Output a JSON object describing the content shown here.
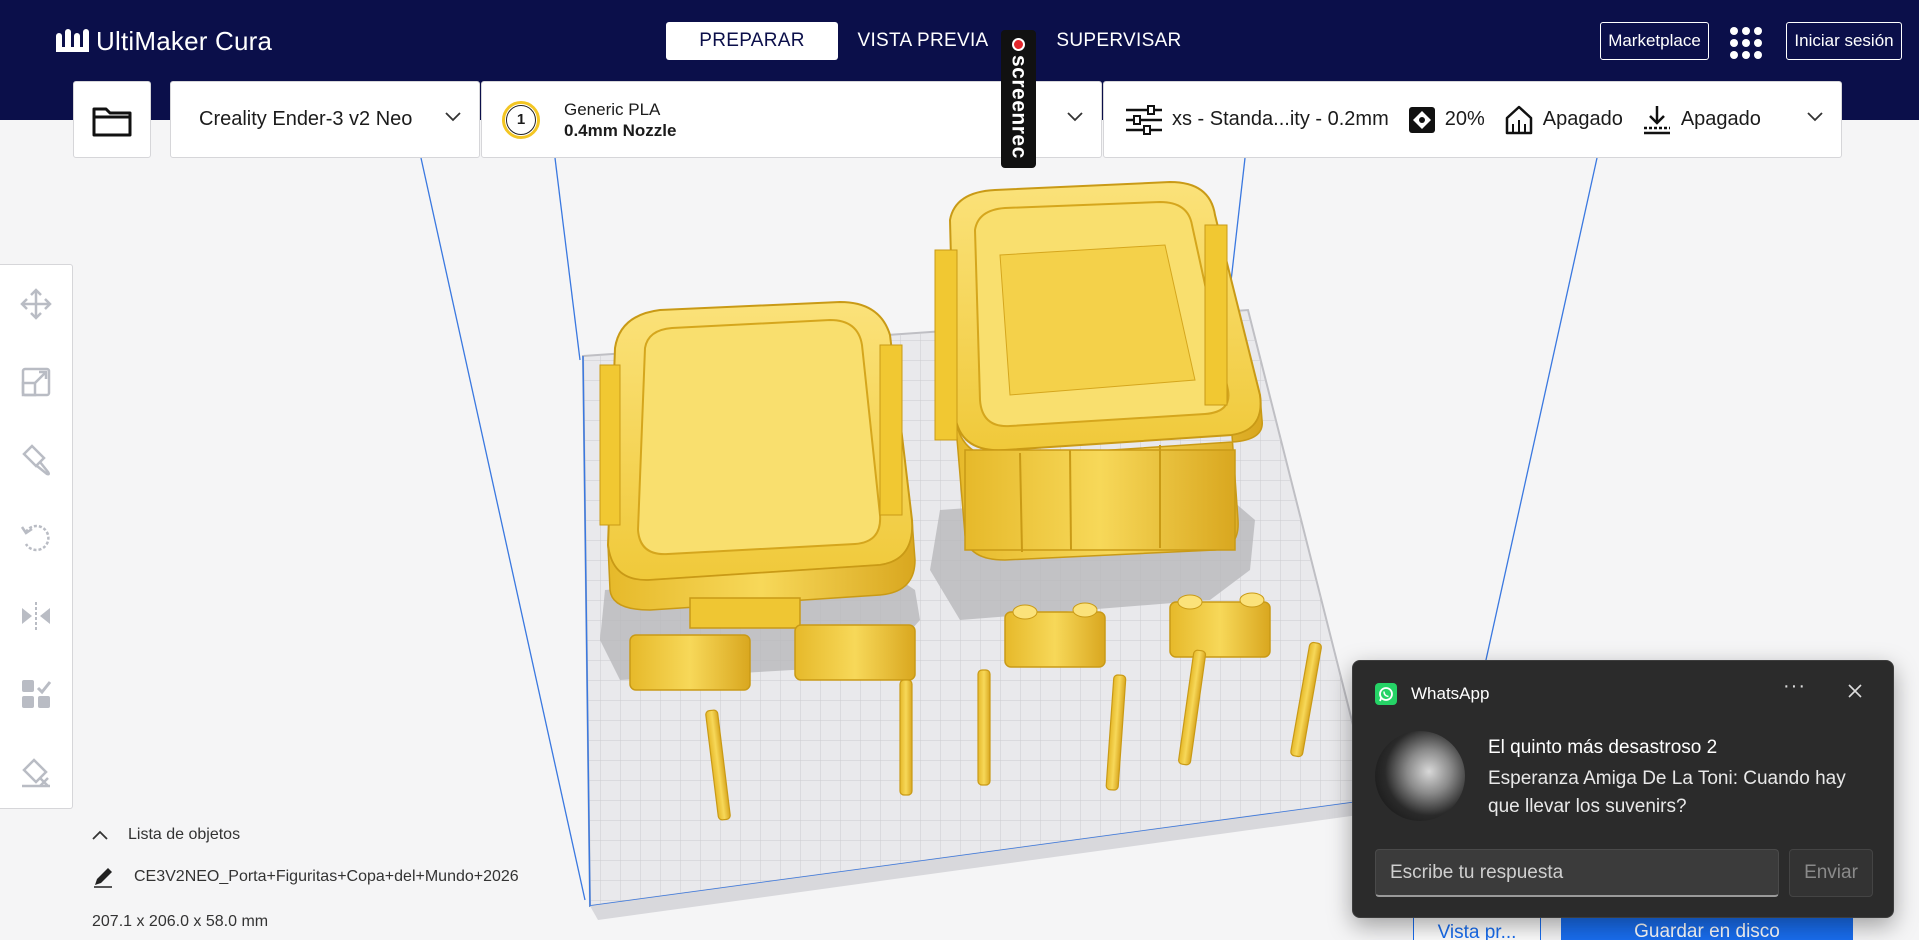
{
  "header": {
    "app_name": "UltiMaker Cura",
    "tabs": [
      {
        "label": "PREPARAR",
        "active": true
      },
      {
        "label": "VISTA PREVIA",
        "active": false
      },
      {
        "label": "SUPERVISAR",
        "active": false
      }
    ],
    "marketplace_label": "Marketplace",
    "signin_label": "Iniciar sesión"
  },
  "recording_badge": "screenrec",
  "printer_panel": {
    "printer_name": "Creality Ender-3 v2 Neo"
  },
  "material_panel": {
    "extruder_number": "1",
    "material_name": "Generic PLA",
    "nozzle": "0.4mm Nozzle"
  },
  "settings_panel": {
    "profile": "xs - Standa...ity - 0.2mm",
    "infill": "20%",
    "support": "Apagado",
    "adhesion": "Apagado"
  },
  "toolbar": {
    "tools": [
      "move-icon",
      "scale-icon",
      "paint-icon",
      "rotate-icon",
      "mirror-icon",
      "per-model-settings-icon",
      "support-blocker-icon"
    ]
  },
  "object_list": {
    "header": "Lista de objetos",
    "item": "CE3V2NEO_Porta+Figuritas+Copa+del+Mundo+2026",
    "dimensions": "207.1 x 206.0 x 58.0 mm"
  },
  "actions": {
    "preview_label": "Vista pr...",
    "save_label": "Guardar en disco"
  },
  "notification": {
    "app": "WhatsApp",
    "title": "El quinto más desastroso 2",
    "message": "Esperanza Amiga De La Toni: Cuando hay que llevar los suvenirs?",
    "reply_placeholder": "Escribe tu respuesta",
    "send_label": "Enviar",
    "more_label": "···"
  },
  "colors": {
    "header_bg": "#0b0f4a",
    "accent": "#196ef0",
    "model": "#f5d44a",
    "whatsapp": "#25d366"
  }
}
